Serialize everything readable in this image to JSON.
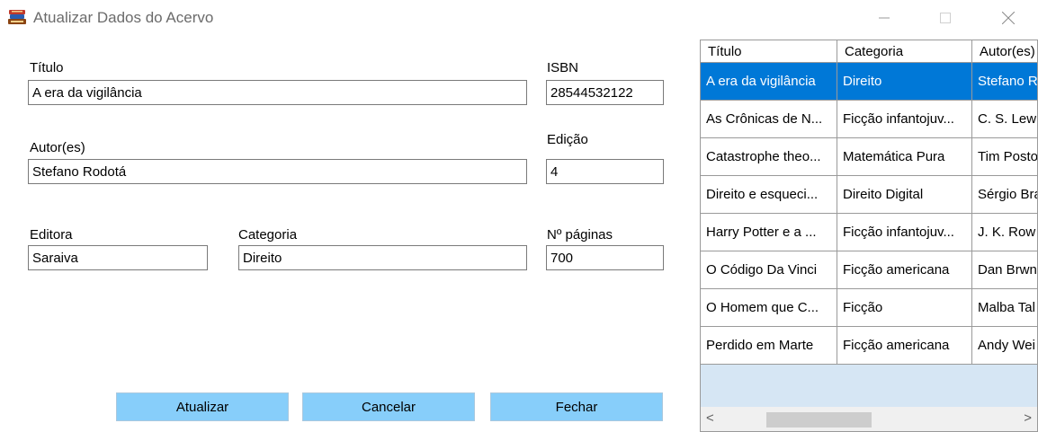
{
  "window": {
    "title": "Atualizar Dados do Acervo",
    "icon": "books-icon",
    "controls": {
      "minimize": "—",
      "maximize": "☐",
      "close": "✕"
    }
  },
  "form": {
    "titulo_label": "Título",
    "titulo_value": "A era da vigilância",
    "isbn_label": "ISBN",
    "isbn_value": "28544532122",
    "autor_label": "Autor(es)",
    "autor_value": "Stefano Rodotá",
    "edicao_label": "Edição",
    "edicao_value": "4",
    "editora_label": "Editora",
    "editora_value": "Saraiva",
    "categoria_label": "Categoria",
    "categoria_value": "Direito",
    "paginas_label": "Nº páginas",
    "paginas_value": "700"
  },
  "buttons": {
    "atualizar": "Atualizar",
    "cancelar": "Cancelar",
    "fechar": "Fechar"
  },
  "grid": {
    "headers": [
      "Título",
      "Categoria",
      "Autor(es)"
    ],
    "selected_row": 0,
    "rows": [
      [
        "A era da vigilância",
        "Direito",
        "Stefano R"
      ],
      [
        "As Crônicas de N...",
        "Ficção infantojuv...",
        "C. S. Lew"
      ],
      [
        "Catastrophe theo...",
        "Matemática Pura",
        "Tim Posto"
      ],
      [
        "Direito e esqueci...",
        "Direito Digital",
        "Sérgio Bra"
      ],
      [
        "Harry Potter e a ...",
        "Ficção infantojuv...",
        "J. K. Row"
      ],
      [
        "O Código Da Vinci",
        "Ficção americana",
        "Dan Brwn"
      ],
      [
        "O Homem que C...",
        "Ficção",
        "Malba Tal"
      ],
      [
        "Perdido em Marte",
        "Ficção americana",
        "Andy Wei"
      ]
    ],
    "scroll_left": "<",
    "scroll_right": ">"
  },
  "colors": {
    "button_bg": "#87cefa",
    "selection": "#0078d7",
    "grid_empty": "#d6e6f4"
  }
}
